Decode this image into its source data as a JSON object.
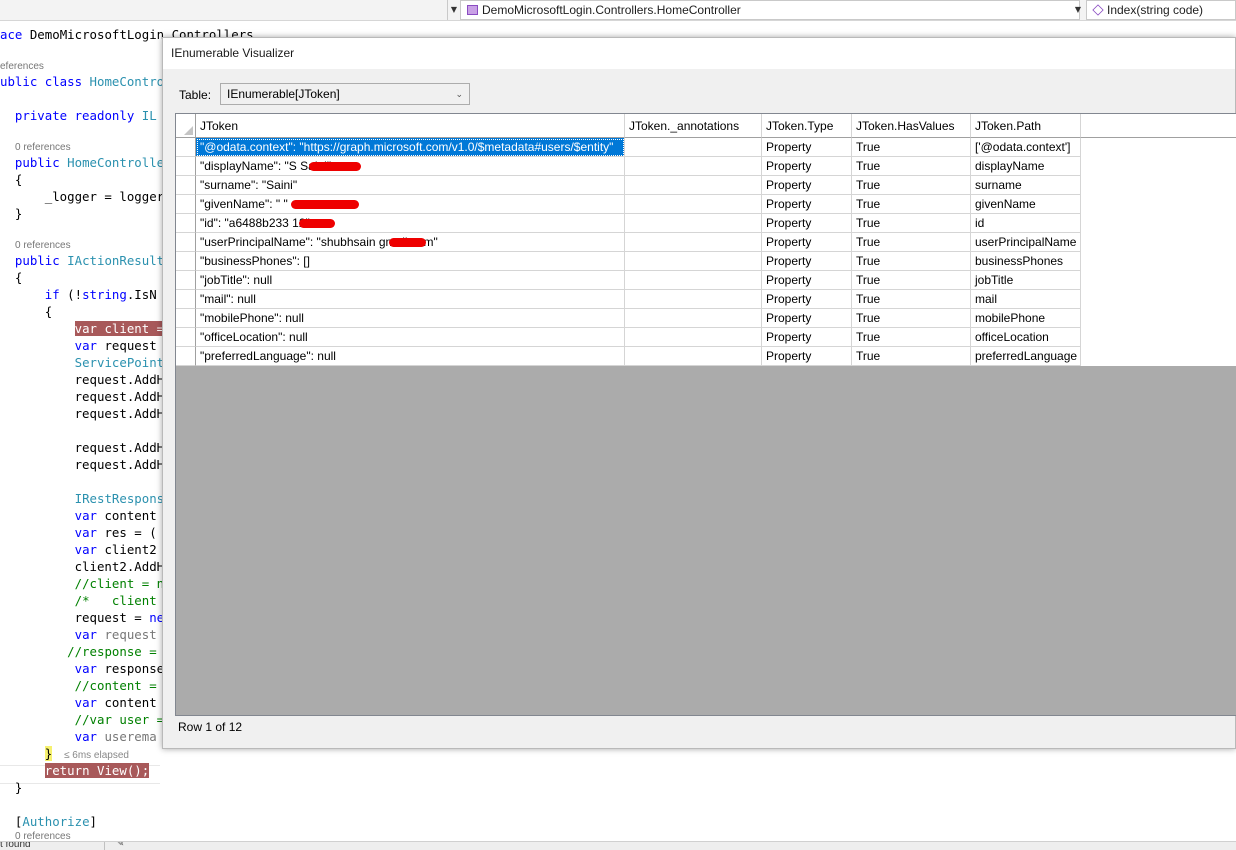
{
  "nav": {
    "class_path": "DemoMicrosoftLogin.Controllers.HomeController",
    "method": "Index(string code)"
  },
  "code": {
    "lines": [
      "ace DemoMicrosoftLogin.Controllers",
      "ublic class HomeControl",
      "private readonly IL",
      "public HomeControlle",
      "{",
      "_logger = logger",
      "}",
      "public IActionResult",
      "{",
      "if (!string.IsN",
      "{",
      "var client =",
      "var request",
      "ServicePoint",
      "request.AddH",
      "request.AddH",
      "request.AddH",
      "request.AddH",
      "request.AddH",
      "IRestRespons",
      "var content",
      "var res = (",
      "var client2",
      "client2.AddH",
      "//client = n",
      "/*   client",
      "request = ne",
      "var request",
      "//response =",
      "var response",
      "//content =",
      "var content",
      "//var user =",
      "var userema",
      "}",
      "return View();",
      "}",
      "[Authorize]"
    ],
    "refs": [
      "eferences",
      "0 references",
      "0 references",
      "0 references"
    ],
    "elapsed": "≤ 6ms elapsed"
  },
  "status": {
    "text": "t found"
  },
  "visualizer": {
    "title": "IEnumerable Visualizer",
    "table_label": "Table:",
    "table_value": "IEnumerable[JToken]",
    "columns": [
      "JToken",
      "JToken._annotations",
      "JToken.Type",
      "JToken.HasValues",
      "JToken.Path"
    ],
    "rows": [
      {
        "token": "\"@odata.context\": \"https://graph.microsoft.com/v1.0/$metadata#users/$entity\"",
        "annotations": "",
        "type": "Property",
        "has_values": "True",
        "path": "['@odata.context']"
      },
      {
        "token": "\"displayName\": \"S          Saini\"",
        "annotations": "",
        "type": "Property",
        "has_values": "True",
        "path": "displayName"
      },
      {
        "token": "\"surname\": \"Saini\"",
        "annotations": "",
        "type": "Property",
        "has_values": "True",
        "path": "surname"
      },
      {
        "token": "\"givenName\": \"            \"",
        "annotations": "",
        "type": "Property",
        "has_values": "True",
        "path": "givenName"
      },
      {
        "token": "\"id\": \"a6488b233       12\"",
        "annotations": "",
        "type": "Property",
        "has_values": "True",
        "path": "id"
      },
      {
        "token": "\"userPrincipalName\": \"shubhsain          gmail.com\"",
        "annotations": "",
        "type": "Property",
        "has_values": "True",
        "path": "userPrincipalName"
      },
      {
        "token": "\"businessPhones\": []",
        "annotations": "",
        "type": "Property",
        "has_values": "True",
        "path": "businessPhones"
      },
      {
        "token": "\"jobTitle\": null",
        "annotations": "",
        "type": "Property",
        "has_values": "True",
        "path": "jobTitle"
      },
      {
        "token": "\"mail\": null",
        "annotations": "",
        "type": "Property",
        "has_values": "True",
        "path": "mail"
      },
      {
        "token": "\"mobilePhone\": null",
        "annotations": "",
        "type": "Property",
        "has_values": "True",
        "path": "mobilePhone"
      },
      {
        "token": "\"officeLocation\": null",
        "annotations": "",
        "type": "Property",
        "has_values": "True",
        "path": "officeLocation"
      },
      {
        "token": "\"preferredLanguage\": null",
        "annotations": "",
        "type": "Property",
        "has_values": "True",
        "path": "preferredLanguage"
      }
    ],
    "row_count": "Row 1 of 12"
  },
  "colors": {
    "selection": "#0078d7",
    "breakpoint_highlight": "#a8595a",
    "keyword": "#0000ff",
    "type": "#2b91af",
    "comment": "#008000"
  },
  "icons": [
    "class-icon",
    "method-icon",
    "dropdown-arrow-icon"
  ]
}
